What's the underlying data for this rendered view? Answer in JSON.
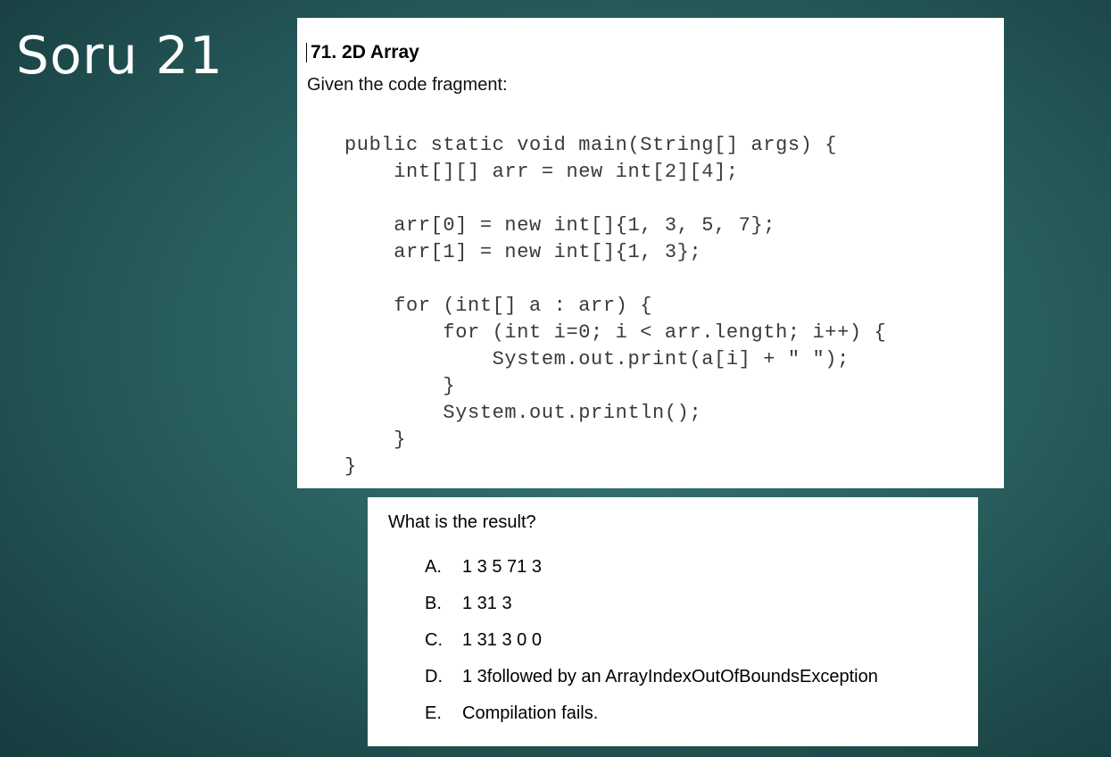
{
  "slide": {
    "title": "Soru 21"
  },
  "question": {
    "heading": "71. 2D Array",
    "intro": "Given the code fragment:",
    "code": "public static void main(String[] args) {\n    int[][] arr = new int[2][4];\n\n    arr[0] = new int[]{1, 3, 5, 7};\n    arr[1] = new int[]{1, 3};\n\n    for (int[] a : arr) {\n        for (int i=0; i < arr.length; i++) {\n            System.out.print(a[i] + \" \");\n        }\n        System.out.println();\n    }\n}"
  },
  "answers": {
    "prompt": "What is the result?",
    "options": [
      {
        "letter": "A.",
        "text": "1 3 5 71 3"
      },
      {
        "letter": "B.",
        "text": "1 31 3"
      },
      {
        "letter": "C.",
        "text": "1 31 3 0 0"
      },
      {
        "letter": "D.",
        "text": "1 3followed by an ArrayIndexOutOfBoundsException"
      },
      {
        "letter": "E.",
        "text": "Compilation fails."
      }
    ]
  }
}
